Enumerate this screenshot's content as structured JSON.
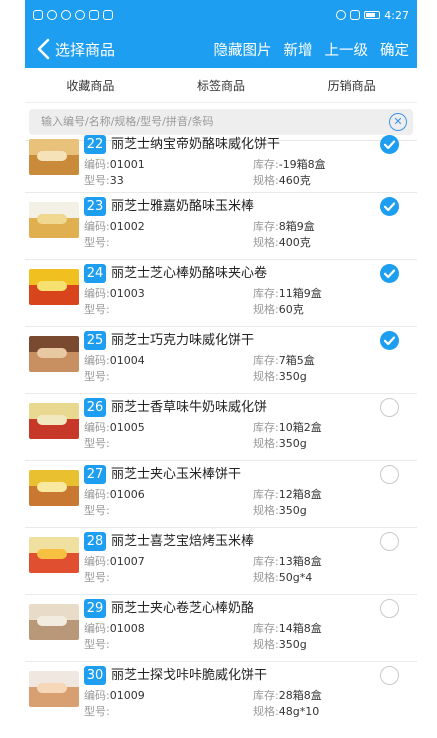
{
  "colors": {
    "accent": "#1e9ef0",
    "checked": "#1e9ef0"
  },
  "status_bar": {
    "time": "4:27"
  },
  "header": {
    "title": "选择商品",
    "actions": [
      "隐藏图片",
      "新增",
      "上一级",
      "确定"
    ]
  },
  "tabs": [
    "收藏商品",
    "标签商品",
    "历销商品"
  ],
  "search": {
    "placeholder": "输入编号/名称/规格/型号/拼音/条码"
  },
  "labels": {
    "code": "编码:",
    "model": "型号:",
    "stock": "库存:",
    "spec": "规格:"
  },
  "items": [
    {
      "no": "22",
      "name": "丽芝士纳宝帝奶酪味威化饼干",
      "code": "01001",
      "model": "33",
      "stock": "-19箱8盒",
      "spec": "460克",
      "checked": true
    },
    {
      "no": "23",
      "name": "丽芝士雅嘉奶酪味玉米棒",
      "code": "01002",
      "model": "",
      "stock": "8箱9盒",
      "spec": "400克",
      "checked": true
    },
    {
      "no": "24",
      "name": "丽芝士芝心棒奶酪味夹心卷",
      "code": "01003",
      "model": "",
      "stock": "11箱9盒",
      "spec": "60克",
      "checked": true
    },
    {
      "no": "25",
      "name": "丽芝士巧克力味威化饼干",
      "code": "01004",
      "model": "",
      "stock": "7箱5盒",
      "spec": "350g",
      "checked": true
    },
    {
      "no": "26",
      "name": "丽芝士香草味牛奶味威化饼",
      "code": "01005",
      "model": "",
      "stock": "10箱2盒",
      "spec": "350g",
      "checked": false
    },
    {
      "no": "27",
      "name": "丽芝士夹心玉米棒饼干",
      "code": "01006",
      "model": "",
      "stock": "12箱8盒",
      "spec": "350g",
      "checked": false
    },
    {
      "no": "28",
      "name": "丽芝士喜芝宝焙烤玉米棒",
      "code": "01007",
      "model": "",
      "stock": "13箱8盒",
      "spec": "50g*4",
      "checked": false
    },
    {
      "no": "29",
      "name": "丽芝士夹心卷芝心棒奶酪",
      "code": "01008",
      "model": "",
      "stock": "14箱8盒",
      "spec": "350g",
      "checked": false
    },
    {
      "no": "30",
      "name": "丽芝士探戈咔咔脆威化饼干",
      "code": "01009",
      "model": "",
      "stock": "28箱8盒",
      "spec": "48g*10",
      "checked": false
    }
  ]
}
